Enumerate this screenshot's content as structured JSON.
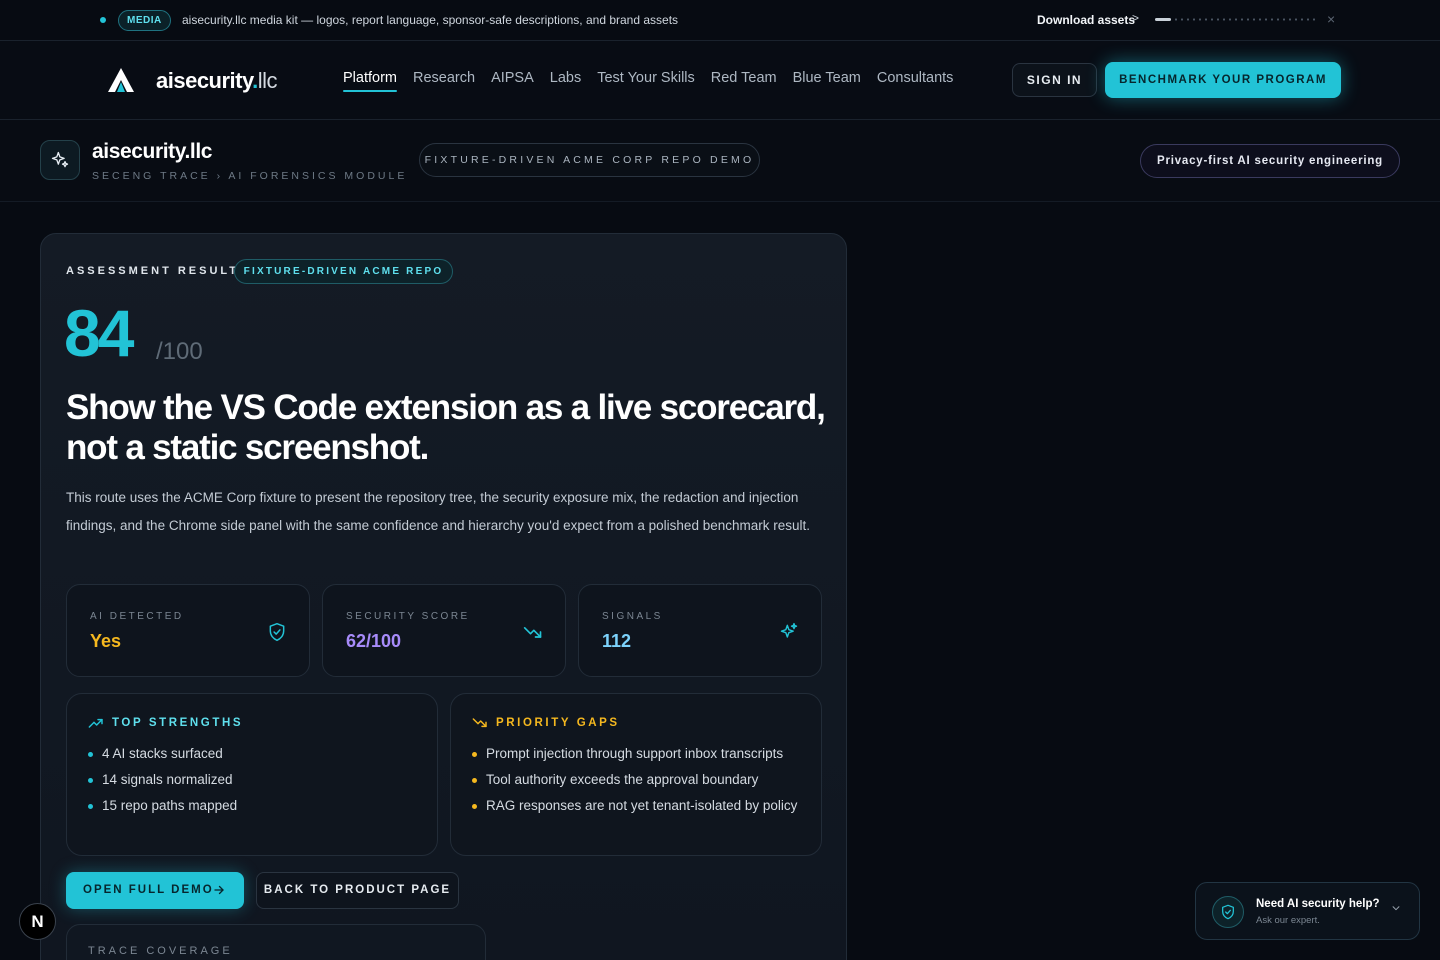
{
  "announce": {
    "badge": "MEDIA",
    "message": "aisecurity.llc media kit — logos, report language, sponsor-safe descriptions, and brand assets",
    "download": "Download assets",
    "chevron": ">",
    "close": "×",
    "carousel_progress": 0.1
  },
  "nav": {
    "brand": "aisecurity",
    "brand_dot": ".",
    "brand_suffix": "llc",
    "links": [
      "Platform",
      "Research",
      "AIPSA",
      "Labs",
      "Test Your Skills",
      "Red Team",
      "Blue Team",
      "Consultants"
    ],
    "active_index": 0,
    "sign_in": "SIGN IN",
    "cta": "BENCHMARK YOUR PROGRAM"
  },
  "module": {
    "title": "aisecurity.llc",
    "subtitle": "SECENG TRACE › AI FORENSICS MODULE",
    "demo_pill": "FIXTURE-DRIVEN ACME CORP REPO DEMO",
    "privacy_pill": "Privacy-first AI security engineering"
  },
  "result": {
    "label": "ASSESSMENT RESULT",
    "pill": "FIXTURE-DRIVEN ACME REPO",
    "score": "84",
    "score_den": "/100",
    "headline": "Show the VS Code extension as a live scorecard, not a static screenshot.",
    "description": "This route uses the ACME Corp fixture to present the repository tree, the security exposure mix, the redaction and injection findings, and the Chrome side panel with the same confidence and hierarchy you'd expect from a polished benchmark result.",
    "stats": [
      {
        "label": "AI DETECTED",
        "value": "Yes",
        "icon": "shield-check-icon",
        "color": "#f5b81f"
      },
      {
        "label": "SECURITY SCORE",
        "value": "62/100",
        "icon": "trending-down-icon",
        "color": "#a78bfa"
      },
      {
        "label": "SIGNALS",
        "value": "112",
        "icon": "sparkles-icon",
        "color": "#7dd3fc"
      }
    ],
    "strengths": {
      "title": "TOP STRENGTHS",
      "items": [
        "4 AI stacks surfaced",
        "14 signals normalized",
        "15 repo paths mapped"
      ]
    },
    "gaps": {
      "title": "PRIORITY GAPS",
      "items": [
        "Prompt injection through support inbox transcripts",
        "Tool authority exceeds the approval boundary",
        "RAG responses are not yet tenant-isolated by policy"
      ]
    },
    "open_demo": "OPEN FULL DEMO",
    "back": "BACK TO PRODUCT PAGE",
    "trace_label": "TRACE COVERAGE"
  },
  "n_badge": "N",
  "help": {
    "title": "Need AI security help?",
    "subtitle": "Ask our expert."
  },
  "colors": {
    "accent": "#22c3d6",
    "amber": "#f5b81f",
    "background": "#070b12"
  }
}
